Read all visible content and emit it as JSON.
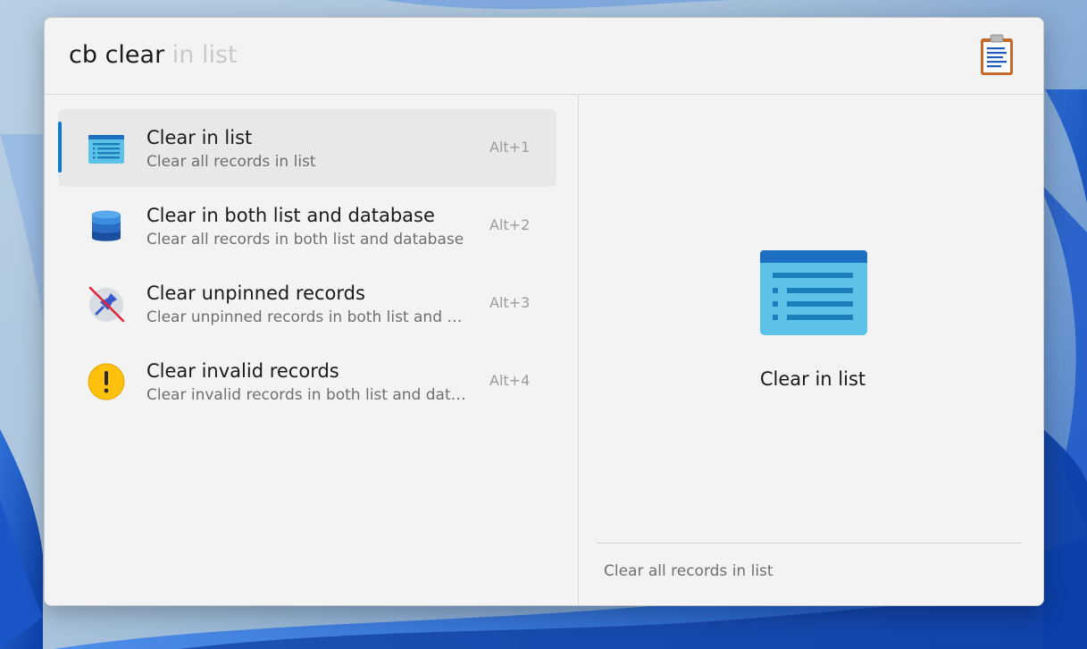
{
  "query": {
    "typed": "cb clear",
    "suggestion": " in list"
  },
  "plugin_icon": "clipboard-icon",
  "results": [
    {
      "title": "Clear in list",
      "subtitle": "Clear all records in list",
      "shortcut": "Alt+1",
      "icon": "list-window-icon",
      "selected": true
    },
    {
      "title": "Clear in both list and database",
      "subtitle": "Clear all records in both list and database",
      "shortcut": "Alt+2",
      "icon": "database-icon",
      "selected": false
    },
    {
      "title": "Clear unpinned records",
      "subtitle": "Clear unpinned records in both list and database",
      "shortcut": "Alt+3",
      "icon": "unpin-icon",
      "selected": false
    },
    {
      "title": "Clear invalid records",
      "subtitle": "Clear invalid records in both list and database",
      "shortcut": "Alt+4",
      "icon": "warning-icon",
      "selected": false
    }
  ],
  "preview": {
    "icon": "list-window-icon",
    "title": "Clear in list",
    "subtitle": "Clear all records in list"
  },
  "colors": {
    "accent": "#0a7ad6",
    "window_bg": "#f3f3f3",
    "selected_bg": "#e8e8e8"
  }
}
